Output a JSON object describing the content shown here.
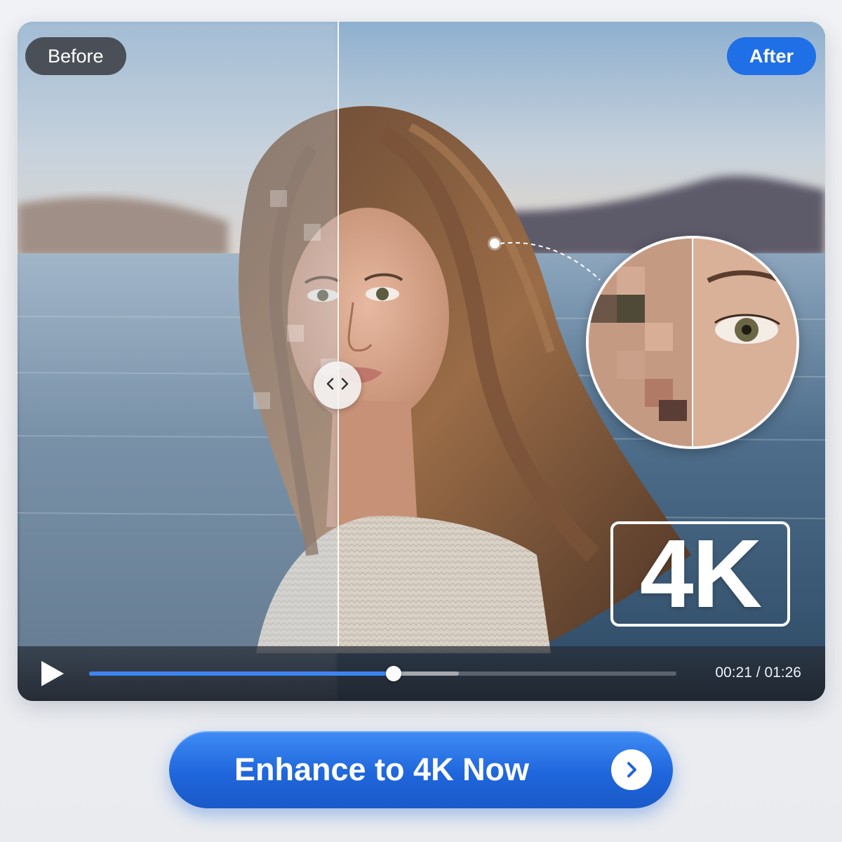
{
  "compare": {
    "before_label": "Before",
    "after_label": "After"
  },
  "badge": {
    "text": "4K"
  },
  "player": {
    "current_time": "00:21",
    "separator": " / ",
    "total_time": "01:26",
    "progress_fraction": 0.518,
    "buffered_fraction": 0.63
  },
  "cta": {
    "label": "Enhance to 4K Now"
  },
  "icons": {
    "handle": "chevrons-left-right-icon",
    "play": "play-icon",
    "cta_arrow": "chevron-right-icon"
  },
  "colors": {
    "accent": "#1f6fe6",
    "progress": "#3d84f2"
  }
}
